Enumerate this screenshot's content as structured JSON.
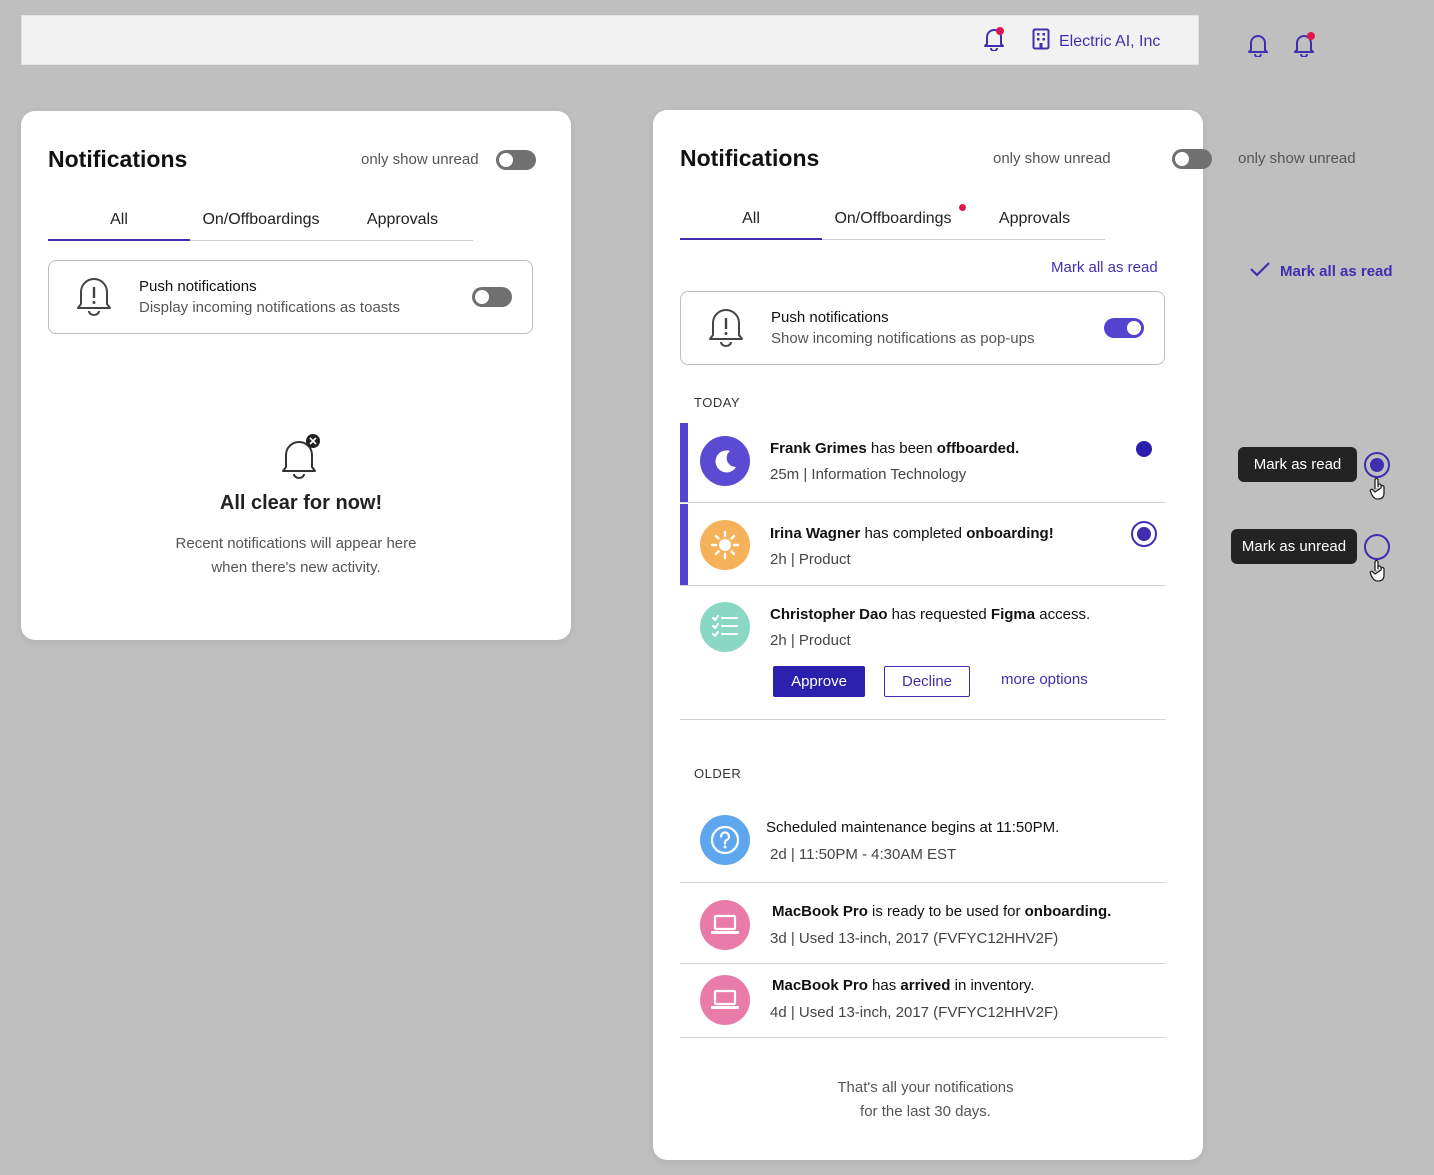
{
  "topbar": {
    "org_name": "Electric AI, Inc"
  },
  "left_panel": {
    "title": "Notifications",
    "only_unread_label": "only show unread",
    "tabs": [
      "All",
      "On/Offboardings",
      "Approvals"
    ],
    "push": {
      "title": "Push notifications",
      "subtitle": "Display incoming notifications as toasts"
    },
    "empty": {
      "title": "All clear for now!",
      "line1": "Recent notifications will appear here",
      "line2": "when there's new activity."
    }
  },
  "right_panel": {
    "title": "Notifications",
    "only_unread_label": "only show unread",
    "tabs": [
      "All",
      "On/Offboardings",
      "Approvals"
    ],
    "mark_all_read": "Mark all as read",
    "push": {
      "title": "Push notifications",
      "subtitle": "Show incoming notifications as pop-ups"
    },
    "today_label": "TODAY",
    "older_label": "OLDER",
    "items": {
      "frank": {
        "name": "Frank Grimes",
        "mid": " has been ",
        "action": "offboarded.",
        "meta": "25m | Information Technology"
      },
      "irina": {
        "name": "Irina Wagner",
        "mid": " has completed ",
        "action": "onboarding!",
        "meta": "2h | Product"
      },
      "chris": {
        "name": "Christopher Dao",
        "mid": " has requested ",
        "app": "Figma",
        "end": " access.",
        "meta": "2h | Product",
        "approve": "Approve",
        "decline": "Decline",
        "more": "more options"
      },
      "maint": {
        "text": "Scheduled maintenance begins at 11:50PM.",
        "meta": "2d | 11:50PM - 4:30AM EST"
      },
      "mac1": {
        "name": "MacBook Pro",
        "mid": " is ready to be used for ",
        "action": "onboarding.",
        "meta": "3d | Used 13-inch, 2017 (FVFYC12HHV2F)"
      },
      "mac2": {
        "name": "MacBook Pro",
        "mid": " has ",
        "action": "arrived",
        "end": " in inventory.",
        "meta": "4d | Used 13-inch, 2017 (FVFYC12HHV2F)"
      }
    },
    "footer": {
      "line1": "That's all your notifications",
      "line2": "for the last 30 days."
    }
  },
  "side": {
    "only_unread_label": "only show unread",
    "mark_all_read": "Mark all as read",
    "tooltip_read": "Mark as read",
    "tooltip_unread": "Mark as unread"
  },
  "colors": {
    "accent": "#3f2fb0",
    "toggle_on": "#5243d0",
    "badge": "#e0184f"
  }
}
